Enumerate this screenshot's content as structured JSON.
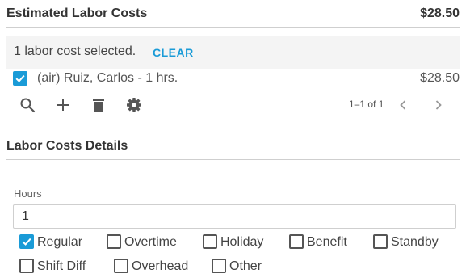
{
  "header": {
    "title": "Estimated Labor Costs",
    "total": "$28.50"
  },
  "selection": {
    "text": "1 labor cost selected.",
    "clear_label": "CLEAR"
  },
  "rows": [
    {
      "description": "(air) Ruiz, Carlos - 1 hrs.",
      "amount": "$28.50",
      "checked": true
    }
  ],
  "toolbar": {
    "icons": [
      "search-icon",
      "add-icon",
      "delete-icon",
      "settings-icon"
    ],
    "pager_text": "1–1 of 1"
  },
  "details": {
    "title": "Labor Costs Details",
    "hours_label": "Hours",
    "hours_value": "1",
    "options": [
      {
        "label": "Regular",
        "checked": true
      },
      {
        "label": "Overtime",
        "checked": false
      },
      {
        "label": "Holiday",
        "checked": false
      },
      {
        "label": "Benefit",
        "checked": false
      },
      {
        "label": "Standby",
        "checked": false
      },
      {
        "label": "Shift Diff",
        "checked": false
      },
      {
        "label": "Overhead",
        "checked": false
      },
      {
        "label": "Other",
        "checked": false
      }
    ]
  },
  "colors": {
    "accent": "#1a9bd7",
    "selection_bg": "#f4f4f4",
    "divider": "#cfcfcf"
  }
}
